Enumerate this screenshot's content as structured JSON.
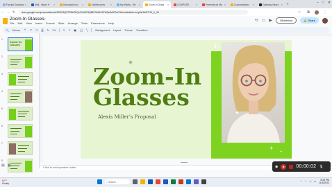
{
  "browser": {
    "tabs": [
      {
        "title": "Faculty Dashboa",
        "color": "#8ab4f8",
        "active": false
      },
      {
        "title": "Mail - Hiyori H",
        "color": "#0a66c2",
        "active": false
      },
      {
        "title": "Introduction to",
        "color": "#f4b400",
        "active": false
      },
      {
        "title": "Untitled pres",
        "color": "#f4b400",
        "active": false
      },
      {
        "title": "My Wistia - Hiv",
        "color": "#54bbff",
        "active": false
      },
      {
        "title": "Zoom-In Glass",
        "color": "#f4b400",
        "active": true
      },
      {
        "title": "COMPOSE",
        "color": "#ea4335",
        "active": false
      },
      {
        "title": "Presenta de Ma",
        "color": "#ea4335",
        "active": false
      },
      {
        "title": "Customization",
        "color": "#f4b400",
        "active": false
      },
      {
        "title": "Gateway Neuro",
        "color": "#202124",
        "active": false
      }
    ],
    "new_tab": "+",
    "url": "docs.google.com/presentation/d/1BGtGQ2TRDkZKQx1XhNC3Q8EVW9bX0FkOjr0k9P0aCWo/edit#slide=id.g2af1bf07f19_0_45"
  },
  "docs": {
    "title": "Zoom-In Glasses",
    "star": "☆",
    "menu": [
      "File",
      "Edit",
      "View",
      "Insert",
      "Format",
      "Slide",
      "Arrange",
      "Tools",
      "Extensions",
      "Help"
    ],
    "slideshow_label": "Slideshow",
    "share_label": "Share"
  },
  "toolbar": {
    "menus_label": "Menus",
    "zoom_label": "Fit",
    "background_label": "Background",
    "layout_label": "Layout",
    "theme_label": "Theme",
    "transition_label": "Transition"
  },
  "filmstrip": {
    "numbers": [
      "1",
      "2",
      "3",
      "4",
      "5",
      "6",
      "7",
      "8",
      "9"
    ],
    "first_thumb_title": "Zoom-In Glasses"
  },
  "slide": {
    "title": "Zoom-In\nGlasses",
    "subtitle": "Alexis Miller's Proposal"
  },
  "notes": {
    "placeholder": "Click to add speaker notes"
  },
  "recorder": {
    "time": "00:00:02"
  },
  "taskbar": {
    "weather_temp": "64°F",
    "weather_desc": "Cloudy",
    "search_placeholder": "Search",
    "time": "5:33 PM",
    "date": "11/6/2023"
  }
}
